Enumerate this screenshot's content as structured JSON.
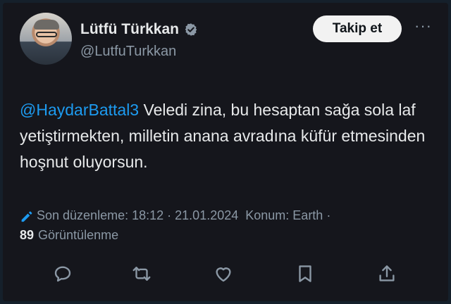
{
  "profile": {
    "name": "Lütfü Türkkan",
    "handle": "@LutfuTurkkan",
    "verified": true
  },
  "header": {
    "follow_label": "Takip et",
    "more_label": "···"
  },
  "tweet": {
    "mention": "@HaydarBattal3",
    "text": " Veledi zina, bu hesaptan sağa sola laf yetiştirmekten, milletin anana avradına küfür etmesinden hoşnut oluyorsun."
  },
  "meta": {
    "edited_label": "Son düzenleme:",
    "time": "18:12",
    "date": "21.01.2024",
    "location_label": "Konum: Earth",
    "views_count": "89",
    "views_label": "Görüntülenme"
  },
  "actions": [
    "reply-icon",
    "retweet-icon",
    "like-icon",
    "bookmark-icon",
    "share-icon"
  ],
  "colors": {
    "background": "#15161c",
    "text": "#e7e9ea",
    "secondary": "#8b98a5",
    "link": "#1d9bf0",
    "follow_bg": "#f2f2f2"
  }
}
